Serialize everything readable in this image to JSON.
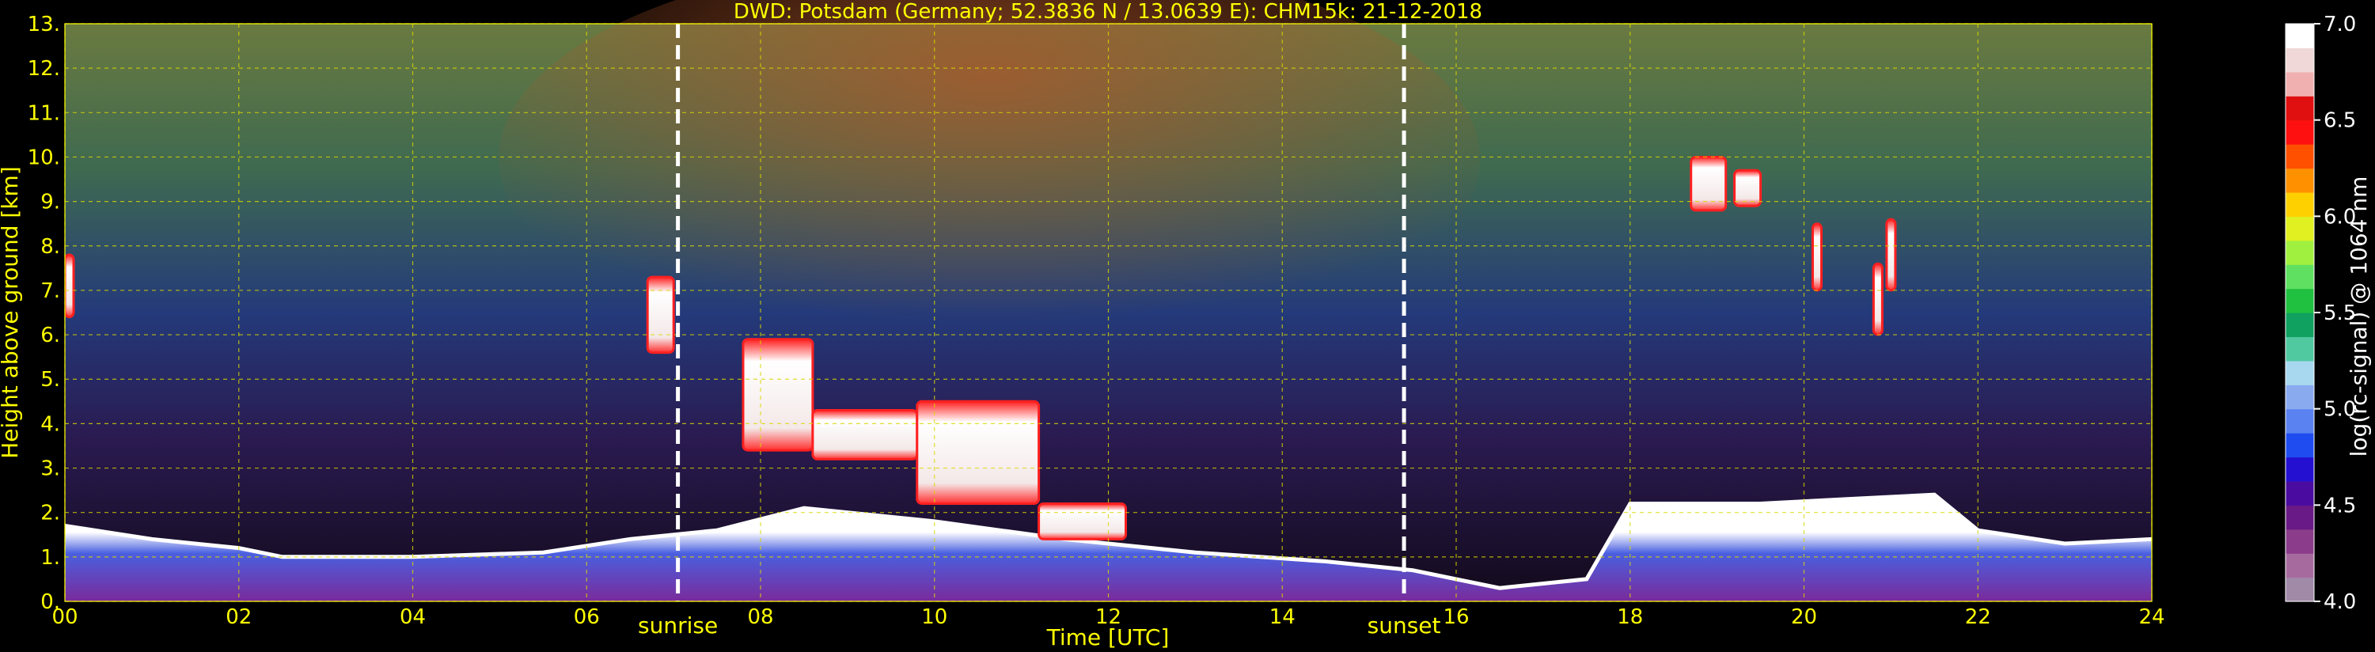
{
  "chart_data": {
    "type": "heatmap",
    "title": "DWD: Potsdam (Germany; 52.3836 N / 13.0639 E):    CHM15k: 21-12-2018",
    "xlabel": "Time [UTC]",
    "ylabel": "Height above ground [km]",
    "x_ticks": [
      "00",
      "02",
      "04",
      "06",
      "08",
      "10",
      "12",
      "14",
      "16",
      "18",
      "20",
      "22",
      "24"
    ],
    "y_ticks": [
      "0.",
      "1.",
      "2.",
      "3.",
      "4.",
      "5.",
      "6.",
      "7.",
      "8.",
      "9.",
      "10.",
      "11.",
      "12.",
      "13."
    ],
    "xlim": [
      0,
      24
    ],
    "ylim": [
      0,
      13
    ],
    "grid": true,
    "markers": [
      {
        "label": "sunrise",
        "time_h": 7.05
      },
      {
        "label": "sunset",
        "time_h": 15.4
      }
    ],
    "colorbar": {
      "label": "log(rc-signal) @ 1064 nm",
      "ticks": [
        "4.0",
        "4.5",
        "5.0",
        "5.5",
        "6.0",
        "6.5",
        "7.0"
      ],
      "range": [
        4.0,
        7.0
      ],
      "colors": [
        "#a08aa8",
        "#a76a9e",
        "#8b3c8a",
        "#6a1a86",
        "#4a0ca0",
        "#2410d0",
        "#1e4cf0",
        "#5a82f0",
        "#8aaaf0",
        "#a8d8f0",
        "#50c8a0",
        "#10a060",
        "#20c040",
        "#60e060",
        "#a0f040",
        "#e0f020",
        "#ffd000",
        "#ff9000",
        "#ff5000",
        "#ff1010",
        "#e01010",
        "#f0b0b0",
        "#f0d8d8",
        "#ffffff"
      ]
    },
    "features": {
      "boundary_layer": [
        {
          "t": 0.0,
          "top": 1.7
        },
        {
          "t": 1.0,
          "top": 1.4
        },
        {
          "t": 2.0,
          "top": 1.2
        },
        {
          "t": 2.5,
          "top": 1.0
        },
        {
          "t": 4.0,
          "top": 1.0
        },
        {
          "t": 5.5,
          "top": 1.1
        },
        {
          "t": 6.5,
          "top": 1.4
        },
        {
          "t": 7.5,
          "top": 1.6
        },
        {
          "t": 8.5,
          "top": 2.1
        },
        {
          "t": 10.0,
          "top": 1.8
        },
        {
          "t": 11.5,
          "top": 1.4
        },
        {
          "t": 13.0,
          "top": 1.1
        },
        {
          "t": 14.5,
          "top": 0.9
        },
        {
          "t": 15.5,
          "top": 0.7
        },
        {
          "t": 16.5,
          "top": 0.3
        },
        {
          "t": 17.5,
          "top": 0.5
        },
        {
          "t": 18.0,
          "top": 2.2
        },
        {
          "t": 19.5,
          "top": 2.2
        },
        {
          "t": 20.5,
          "top": 2.3
        },
        {
          "t": 21.5,
          "top": 2.4
        },
        {
          "t": 22.0,
          "top": 1.6
        },
        {
          "t": 23.0,
          "top": 1.3
        },
        {
          "t": 24.0,
          "top": 1.4
        }
      ],
      "clouds": [
        {
          "t0": 7.8,
          "t1": 8.6,
          "base": 3.4,
          "top": 5.9
        },
        {
          "t0": 8.6,
          "t1": 9.8,
          "base": 3.2,
          "top": 4.3
        },
        {
          "t0": 9.8,
          "t1": 11.2,
          "base": 2.2,
          "top": 4.5
        },
        {
          "t0": 11.2,
          "t1": 12.2,
          "base": 1.4,
          "top": 2.2
        },
        {
          "t0": 6.7,
          "t1": 7.0,
          "base": 5.6,
          "top": 7.3
        },
        {
          "t0": 0.0,
          "t1": 0.1,
          "base": 6.4,
          "top": 7.8
        },
        {
          "t0": 18.7,
          "t1": 19.1,
          "base": 8.8,
          "top": 10.0
        },
        {
          "t0": 19.2,
          "t1": 19.5,
          "base": 8.9,
          "top": 9.7
        },
        {
          "t0": 20.1,
          "t1": 20.2,
          "base": 7.0,
          "top": 8.5
        },
        {
          "t0": 20.8,
          "t1": 20.9,
          "base": 6.0,
          "top": 7.6
        },
        {
          "t0": 20.95,
          "t1": 21.05,
          "base": 7.0,
          "top": 8.6
        }
      ]
    }
  }
}
